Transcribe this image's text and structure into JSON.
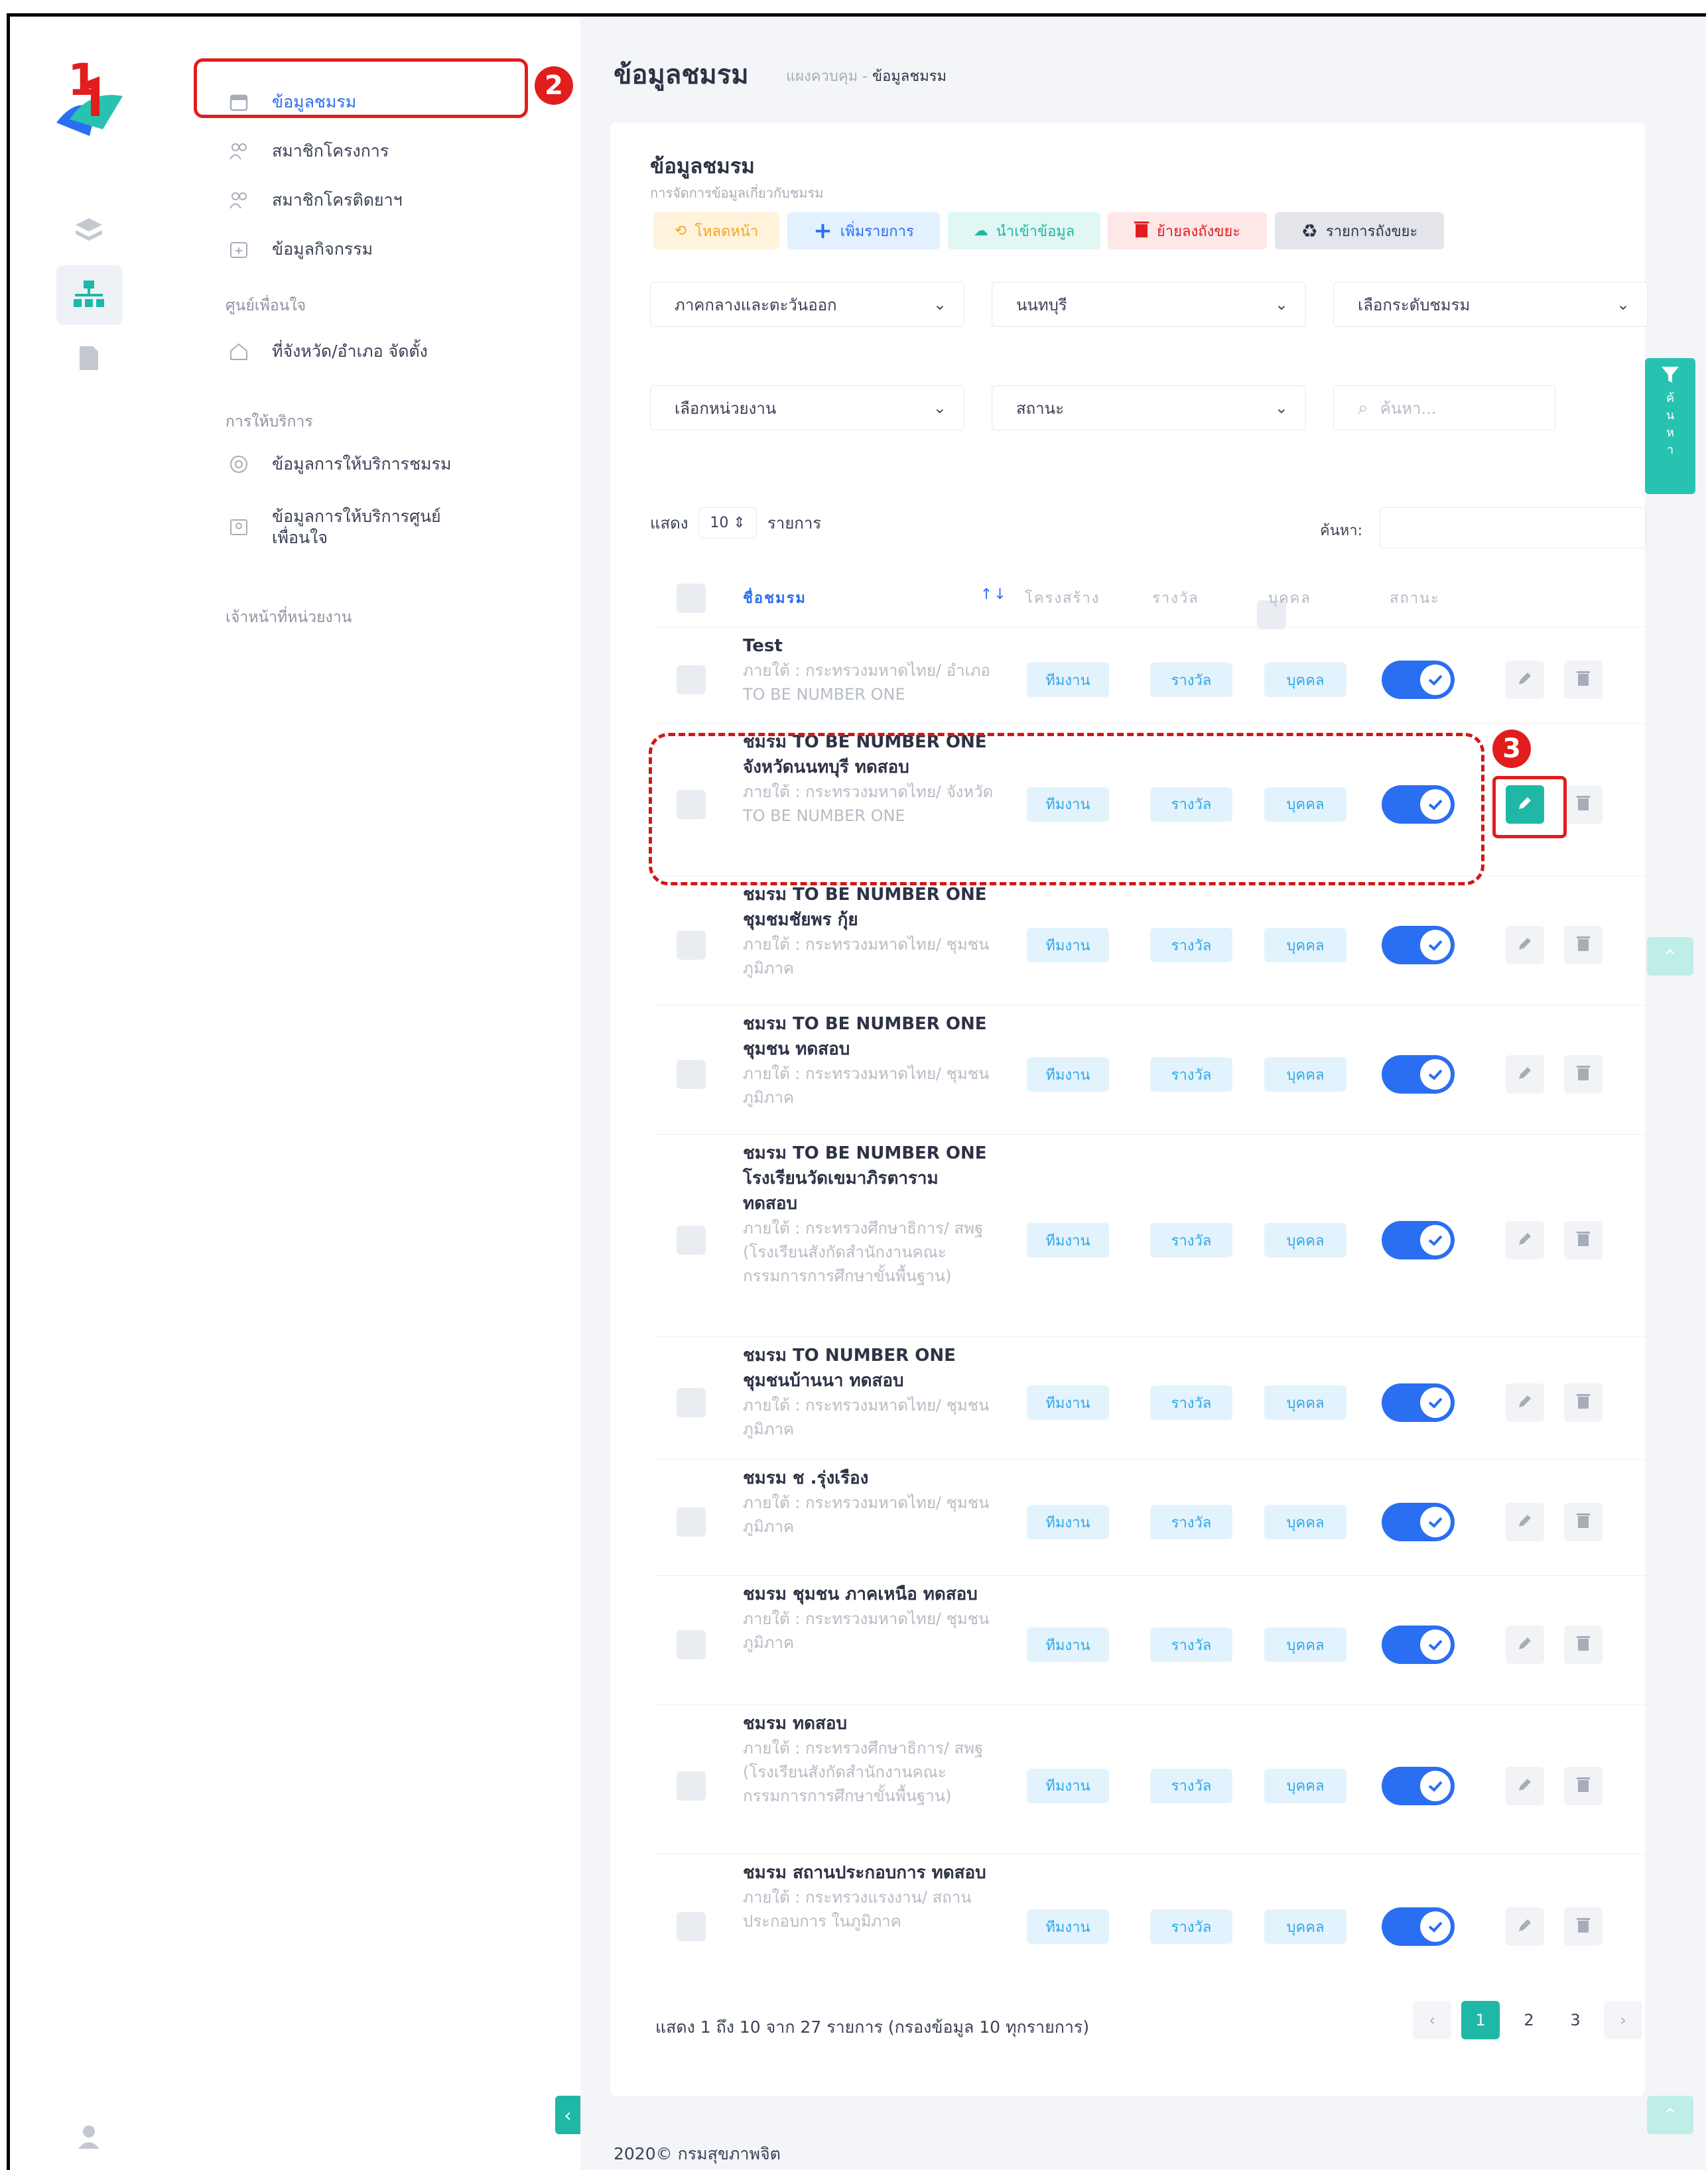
{
  "annotations": {
    "n1": "1",
    "n2": "2",
    "n3": "3"
  },
  "sidebar": {
    "items": [
      {
        "label": "ข้อมูลชมรม"
      },
      {
        "label": "สมาชิกโครงการ"
      },
      {
        "label": "สมาชิกโครติดยาฯ"
      },
      {
        "label": "ข้อมูลกิจกรรม"
      }
    ],
    "group1": "ศูนย์เพื่อนใจ",
    "group1_items": [
      {
        "label": "ที่จังหวัด/อำเภอ จัดตั้ง"
      }
    ],
    "group2": "การให้บริการ",
    "group2_items": [
      {
        "label": "ข้อมูลการให้บริการชมรม"
      },
      {
        "label": "ข้อมูลการให้บริการศูนย์"
      },
      {
        "label": "เพื่อนใจ"
      }
    ],
    "group3": "เจ้าหน้าที่หน่วยงาน"
  },
  "header": {
    "title": "ข้อมูลชมรม",
    "crumb_home": "แผงควบคุม",
    "crumb_sep": "-",
    "crumb_current": "ข้อมูลชมรม"
  },
  "card": {
    "title": "ข้อมูลชมรม",
    "subtitle": "การจัดการข้อมูลเกี่ยวกับชมรม"
  },
  "toolbar": {
    "reload": "โหลดหน้า",
    "add": "เพิ่มรายการ",
    "import": "นำเข้าข้อมูล",
    "delete": "ย้ายลงถังขยะ",
    "trash": "รายการถังขยะ"
  },
  "filters": {
    "region": "ภาคกลางและตะวันออก",
    "province": "นนทบุรี",
    "level": "เลือกระดับชมรม",
    "unit": "เลือกหน่วยงาน",
    "status": "สถานะ",
    "search_placeholder": "ค้นหา...",
    "search_side_label": [
      "ค้",
      "น",
      "ห",
      "า"
    ]
  },
  "list": {
    "show_prefix": "แสดง",
    "page_size": "10",
    "show_suffix": "รายการ",
    "search_label": "ค้นหา:"
  },
  "table": {
    "headers": {
      "club": "ชื่อชมรม",
      "sort": "↑↓",
      "structure": "โครงสร้าง",
      "award": "รางวัล",
      "person": "บุคคล",
      "status": "สถานะ"
    },
    "pill_labels": {
      "work": "ทีมงาน",
      "award": "รางวัล",
      "person": "บุคคล"
    },
    "rows": [
      {
        "name": "Test",
        "sub": "ภายใต้ : กระทรวงมหาดไทย/ อำเภอ TO BE NUMBER ONE"
      },
      {
        "name": "ชมรม TO BE NUMBER ONE จังหวัดนนทบุรี ทดสอบ",
        "sub": "ภายใต้ : กระทรวงมหาดไทย/ จังหวัด TO BE NUMBER ONE"
      },
      {
        "name": "ชมรม TO BE NUMBER ONE ชุมชมชัยพร กุ้ย",
        "sub": "ภายใต้ : กระทรวงมหาดไทย/ ชุมชนภูมิภาค"
      },
      {
        "name": "ชมรม TO BE NUMBER ONE ชุมชน ทดสอบ",
        "sub": "ภายใต้ : กระทรวงมหาดไทย/ ชุมชนภูมิภาค"
      },
      {
        "name": "ชมรม TO BE NUMBER ONE โรงเรียนวัดเขมาภิรตาราม ทดสอบ",
        "sub": "ภายใต้ : กระทรวงศึกษาธิการ/ สพฐ (โรงเรียนสังกัดสำนักงานคณะกรรมการการศึกษาขั้นพื้นฐาน)"
      },
      {
        "name": "ชมรม TO NUMBER ONE ชุมชนบ้านนา ทดสอบ",
        "sub": "ภายใต้ : กระทรวงมหาดไทย/ ชุมชนภูมิภาค"
      },
      {
        "name": "ชมรม ช .รุ่งเรือง",
        "sub": "ภายใต้ : กระทรวงมหาดไทย/ ชุมชนภูมิภาค"
      },
      {
        "name": "ชมรม ชุมชน ภาคเหนือ ทดสอบ",
        "sub": "ภายใต้ : กระทรวงมหาดไทย/ ชุมชนภูมิภาค"
      },
      {
        "name": "ชมรม ทดสอบ",
        "sub": "ภายใต้ : กระทรวงศึกษาธิการ/ สพฐ (โรงเรียนสังกัดสำนักงานคณะกรรมการการศึกษาขั้นพื้นฐาน)"
      },
      {
        "name": "ชมรม สถานประกอบการ ทดสอบ",
        "sub": "ภายใต้ : กระทรวงแรงงาน/ สถานประกอบการ ในภูมิภาค"
      }
    ]
  },
  "footer_info": "แสดง 1 ถึง 10 จาก 27 รายการ (กรองข้อมูล 10 ทุกรายการ)",
  "pagination": {
    "prev": "‹",
    "pages": [
      "1",
      "2",
      "3"
    ],
    "next": "›"
  },
  "copyright": "2020© กรมสุขภาพจิต",
  "colors": {
    "accent": "#1fb8a6",
    "toggle": "#2a6ef1",
    "annotation": "#e21d1d",
    "pill_text": "#30a8e6"
  }
}
